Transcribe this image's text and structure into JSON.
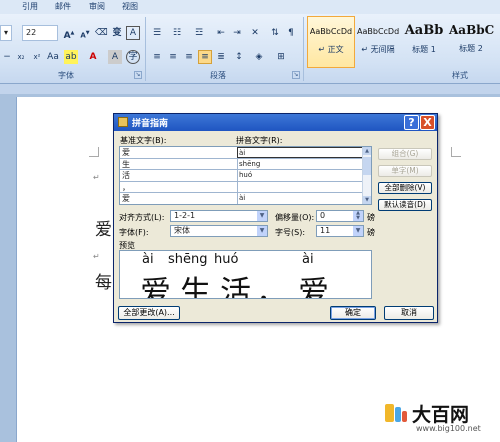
{
  "menu": {
    "tabs": [
      "引用",
      "邮件",
      "审阅",
      "视图"
    ]
  },
  "ribbon": {
    "font_size": "22",
    "groups": {
      "font": "字体",
      "paragraph": "段落",
      "styles": "样式"
    },
    "styles": [
      {
        "preview": "AaBbCcDd",
        "name": "↵ 正文",
        "selected": true
      },
      {
        "preview": "AaBbCcDd",
        "name": "↵ 无间隔",
        "selected": false
      },
      {
        "preview": "AaBb",
        "name": "标题 1",
        "selected": false
      },
      {
        "preview": "AaBbC",
        "name": "标题 2",
        "selected": false
      }
    ]
  },
  "document": {
    "line1": "爱",
    "line2": "每"
  },
  "dialog": {
    "title": "拼音指南",
    "close_glyph": "X",
    "help_glyph": "?",
    "col_base": "基准文字(B):",
    "col_pinyin": "拼音文字(R):",
    "rows": [
      {
        "base": "爱",
        "pinyin": "ài"
      },
      {
        "base": "生",
        "pinyin": "shēng"
      },
      {
        "base": "活",
        "pinyin": "huó"
      },
      {
        "base": "，",
        "pinyin": ""
      },
      {
        "base": "爱",
        "pinyin": "ài"
      }
    ],
    "buttons_side": {
      "combine": "组合(G)",
      "single": "单字(M)",
      "clear_all": "全部删除(V)",
      "default_reading": "默认读音(D)"
    },
    "align_label": "对齐方式(L):",
    "align_value": "1-2-1",
    "offset_label": "偏移量(O):",
    "offset_value": "0",
    "offset_unit": "磅",
    "font_label": "字体(F):",
    "font_value": "宋体",
    "size_label": "字号(S):",
    "size_value": "11",
    "size_unit": "磅",
    "preview_label": "预览",
    "preview_pinyin": [
      "ài",
      "shēng",
      "huó",
      "ài"
    ],
    "preview_chars": [
      "爱",
      "生",
      "活",
      "，",
      "爱"
    ],
    "btn_change_all": "全部更改(A)...",
    "btn_ok": "确定",
    "btn_cancel": "取消"
  },
  "watermark": {
    "text": "大百网",
    "url": "www.big100.net"
  }
}
